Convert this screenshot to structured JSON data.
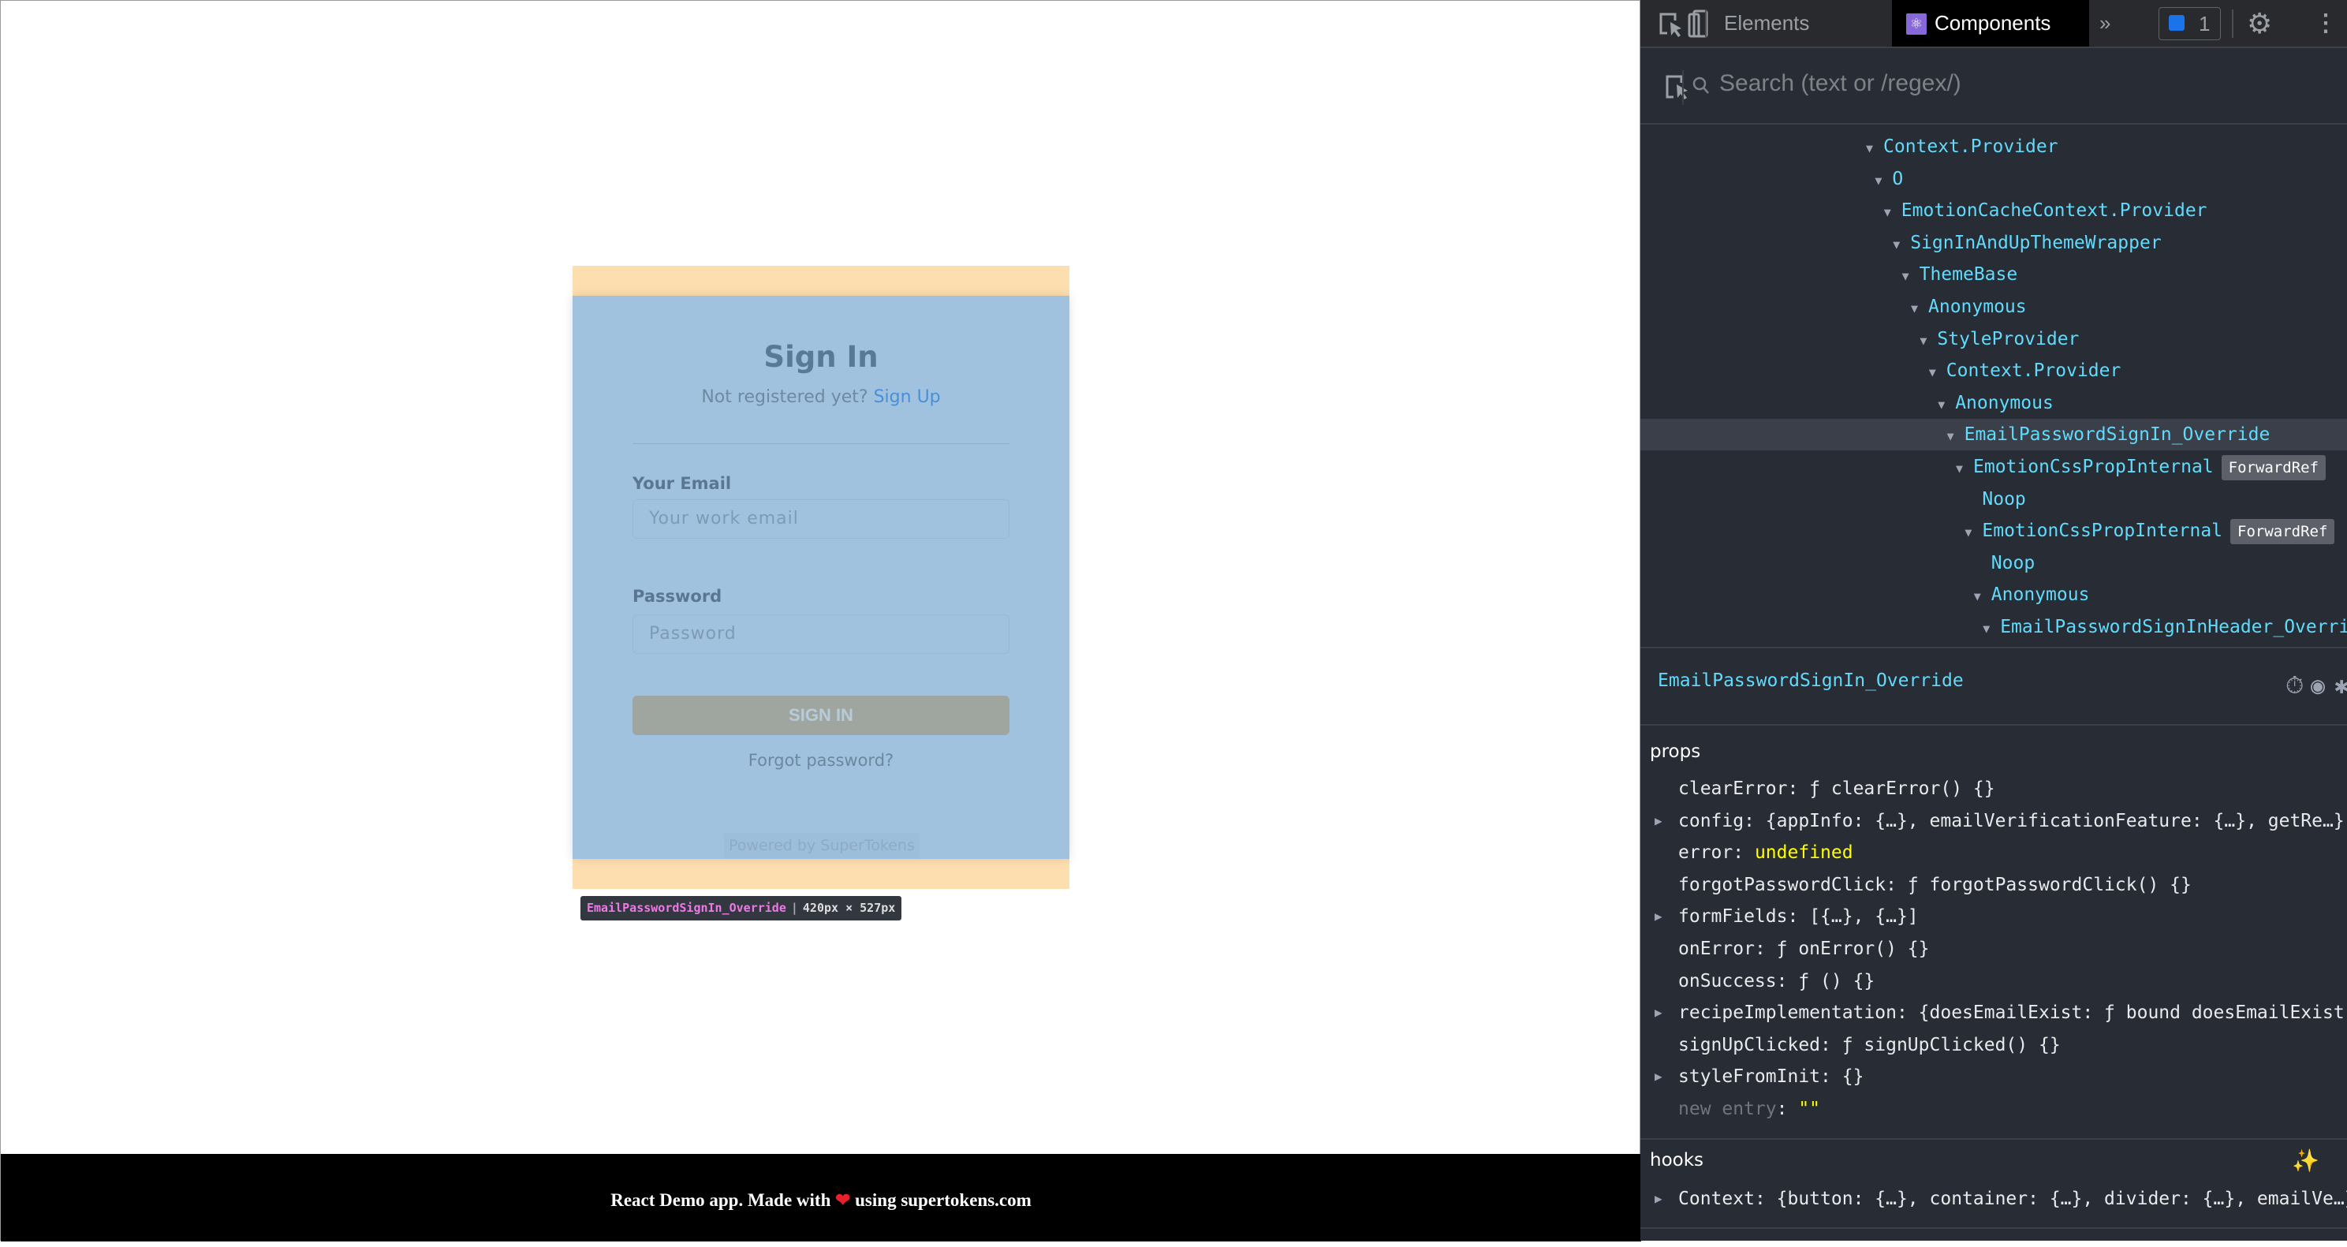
{
  "page": {
    "card": {
      "title": "Sign In",
      "subtitle": "Not registered yet?",
      "signup_link": "Sign Up",
      "email_label": "Your Email",
      "email_placeholder": "Your work email",
      "password_label": "Password",
      "password_placeholder": "Password",
      "submit": "SIGN IN",
      "forgot": "Forgot password?",
      "powered": "Powered by SuperTokens"
    },
    "tooltip": {
      "name": "EmailPasswordSignIn_Override",
      "size": "420px × 527px"
    },
    "footer": {
      "before": "React Demo app. Made with",
      "heart": "❤",
      "after": "using supertokens.com"
    }
  },
  "devtools": {
    "tabs": {
      "elements": "Elements",
      "components": "Components",
      "more": "»"
    },
    "issues_count": "1",
    "search_placeholder": "Search (text or /regex/)",
    "tree": [
      {
        "label": "Context.Provider",
        "depth": 0
      },
      {
        "label": "O",
        "depth": 1
      },
      {
        "label": "EmotionCacheContext.Provider",
        "depth": 2
      },
      {
        "label": "SignInAndUpThemeWrapper",
        "depth": 3
      },
      {
        "label": "ThemeBase",
        "depth": 4
      },
      {
        "label": "Anonymous",
        "depth": 5
      },
      {
        "label": "StyleProvider",
        "depth": 6
      },
      {
        "label": "Context.Provider",
        "depth": 7
      },
      {
        "label": "Anonymous",
        "depth": 8
      },
      {
        "label": "EmailPasswordSignIn_Override",
        "depth": 9,
        "selected": true
      },
      {
        "label": "EmotionCssPropInternal",
        "depth": 10,
        "badge": "ForwardRef"
      },
      {
        "label": "Noop",
        "depth": 11,
        "leaf": true
      },
      {
        "label": "EmotionCssPropInternal",
        "depth": 11,
        "badge": "ForwardRef"
      },
      {
        "label": "Noop",
        "depth": 12,
        "leaf": true
      },
      {
        "label": "Anonymous",
        "depth": 12
      },
      {
        "label": "EmailPasswordSignInHeader_Override",
        "depth": 13
      }
    ],
    "selected_name": "EmailPasswordSignIn_Override",
    "props_title": "props",
    "props": [
      {
        "key": "clearError",
        "value": "ƒ clearError() {}"
      },
      {
        "key": "config",
        "value": "{appInfo: {…}, emailVerificationFeature: {…}, getRe…}",
        "expandable": true
      },
      {
        "key": "error",
        "value": "undefined",
        "special": "undefined"
      },
      {
        "key": "forgotPasswordClick",
        "value": "ƒ forgotPasswordClick() {}"
      },
      {
        "key": "formFields",
        "value": "[{…}, {…}]",
        "expandable": true
      },
      {
        "key": "onError",
        "value": "ƒ onError() {}"
      },
      {
        "key": "onSuccess",
        "value": "ƒ () {}"
      },
      {
        "key": "recipeImplementation",
        "value": "{doesEmailExist: ƒ bound doesEmailExist(",
        "expandable": true
      },
      {
        "key": "signUpClicked",
        "value": "ƒ signUpClicked() {}"
      },
      {
        "key": "styleFromInit",
        "value": "{}",
        "expandable": true
      },
      {
        "key": "new entry",
        "value": "\"\"",
        "special": "new"
      }
    ],
    "hooks_title": "hooks",
    "hooks": [
      {
        "key": "Context",
        "value": "{button: {…}, container: {…}, divider: {…}, emailVe…}",
        "expandable": true
      }
    ]
  }
}
